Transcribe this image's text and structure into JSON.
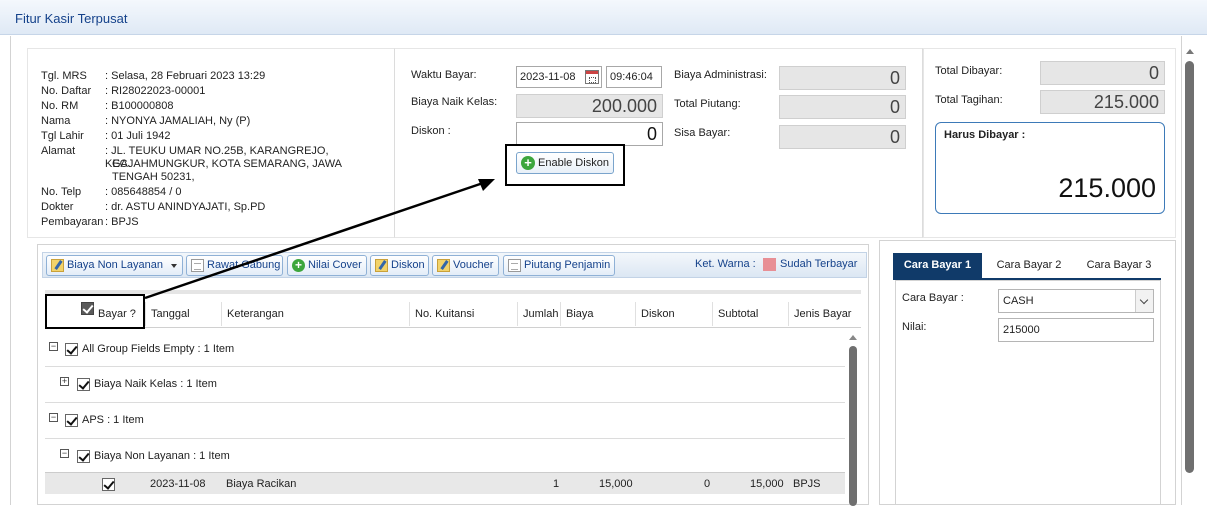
{
  "window": {
    "title": "Fitur Kasir Terpusat"
  },
  "patient": {
    "rows": [
      {
        "label": "Tgl. MRS",
        "value": ": Selasa, 28 Februari 2023 13:29"
      },
      {
        "label": "No. Daftar",
        "value": ": RI28022023-00001"
      },
      {
        "label": "No. RM",
        "value": ": B100000808"
      },
      {
        "label": "Nama",
        "value": ": NYONYA JAMALIAH, Ny (P)"
      },
      {
        "label": "Tgl Lahir",
        "value": ": 01 Juli 1942"
      },
      {
        "label": "Alamat",
        "value": ": JL. TEUKU UMAR NO.25B, KARANGREJO, KEC."
      },
      {
        "label": "",
        "value": "GAJAHMUNGKUR, KOTA SEMARANG, JAWA"
      },
      {
        "label": "",
        "value": "TENGAH 50231,"
      },
      {
        "label": "No. Telp",
        "value": ": 085648854 / 0"
      },
      {
        "label": "Dokter",
        "value": ": dr. ASTU ANINDYAJATI, Sp.PD"
      },
      {
        "label": "Pembayaran",
        "value": ": BPJS"
      }
    ]
  },
  "payment": {
    "waktu_bayar_label": "Waktu Bayar:",
    "date_value": "2023-11-08",
    "time_value": "09:46:04",
    "biaya_naik_kelas_label": "Biaya Naik Kelas:",
    "biaya_naik_kelas_value": "200.000",
    "diskon_label": "Diskon :",
    "diskon_value": "0",
    "enable_diskon_label": "Enable Diskon",
    "biaya_admin_label": "Biaya Administrasi:",
    "biaya_admin_value": "0",
    "total_piutang_label": "Total Piutang:",
    "total_piutang_value": "0",
    "sisa_bayar_label": "Sisa Bayar:",
    "sisa_bayar_value": "0"
  },
  "totals": {
    "total_dibayar_label": "Total Dibayar:",
    "total_dibayar_value": "0",
    "total_tagihan_label": "Total Tagihan:",
    "total_tagihan_value": "215.000",
    "harus_dibayar_label": "Harus Dibayar :",
    "harus_dibayar_value": "215.000"
  },
  "toolbar": {
    "biaya_non_layanan": "Biaya Non Layanan",
    "rawat_gabung": "Rawat Gabung",
    "nilai_cover": "Nilai Cover",
    "diskon": "Diskon",
    "voucher": "Voucher",
    "piutang_penjamin": "Piutang Penjamin",
    "ket_warna": "Ket. Warna :",
    "sudah_terbayar": "Sudah Terbayar",
    "sudah_terbayar_color": "#e88f95"
  },
  "grid": {
    "columns": [
      "Bayar ?",
      "Tanggal",
      "Keterangan",
      "No. Kuitansi",
      "Jumlah",
      "Biaya",
      "Diskon",
      "Subtotal",
      "Jenis Bayar"
    ],
    "groups": [
      "All Group Fields Empty : 1 Item",
      "Biaya Naik Kelas : 1 Item",
      "APS : 1 Item",
      "Biaya Non Layanan : 1 Item"
    ],
    "row": {
      "tanggal": "2023-11-08",
      "keterangan": "Biaya Racikan",
      "jumlah": "1",
      "biaya": "15,000",
      "diskon": "0",
      "subtotal": "15,000",
      "jenis_bayar": "BPJS"
    }
  },
  "cara_bayar": {
    "tabs": [
      "Cara Bayar 1",
      "Cara Bayar 2",
      "Cara Bayar 3"
    ],
    "cara_bayar_label": "Cara Bayar :",
    "cara_bayar_value": "CASH",
    "nilai_label": "Nilai:",
    "nilai_value": "215000"
  }
}
